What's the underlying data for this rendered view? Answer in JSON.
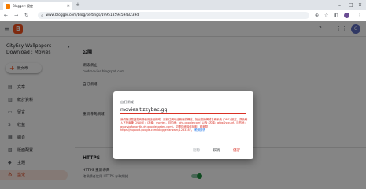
{
  "browser": {
    "tab_title": "Blogger: 設定",
    "url": "www.blogger.com/blog/settings/1995185945943239d"
  },
  "app": {
    "logo_letter": "B",
    "user_initial": "C"
  },
  "sidebar": {
    "blog_name": "CityEsy Wallpapers Download : Movies",
    "new_post_label": "新文章",
    "items": [
      {
        "icon": "▤",
        "label": "文章"
      },
      {
        "icon": "▥",
        "label": "統計資料"
      },
      {
        "icon": "▭",
        "label": "留言"
      },
      {
        "icon": "$",
        "label": "收益"
      },
      {
        "icon": "▦",
        "label": "網頁"
      },
      {
        "icon": "▧",
        "label": "版面配置"
      },
      {
        "icon": "◆",
        "label": "主題"
      },
      {
        "icon": "⚙",
        "label": "設定"
      }
    ]
  },
  "main": {
    "section_public": "公開",
    "blog_address_label": "網誌網址",
    "blog_address_value": "cwdmovies.blogspot.com",
    "custom_domain_label": "自訂網域",
    "redirect_label": "重新導向網域",
    "https_section": "HTTPS",
    "https_redirect_label": "HTTPS 重新導向",
    "https_redirect_desc": "確保讀者使用 HTTPS 存取網誌"
  },
  "dialog": {
    "title": "自訂網域",
    "input_value": "movies.tizzybac.gq",
    "error_text": "我們無法驗證您有權使用這個網域。請前往網域註冊商的網站，找出您的網域名稱系統 (DNS) 設定，然後輸入下列兩筆 CNAME：(名稱：movies，目的地：ghs.google.com) 以及 (名稱：qtbsj2wxuqf，目的地：gv-gvbpfanorf6n.dv.googlehosted.com)。如需詳細操作說明，請參閱 https://support.google.com/blogger/answer/1233387。",
    "learn_more": "瞭解詳情",
    "delete_label": "刪除",
    "cancel_label": "取消",
    "save_label": "儲存"
  }
}
